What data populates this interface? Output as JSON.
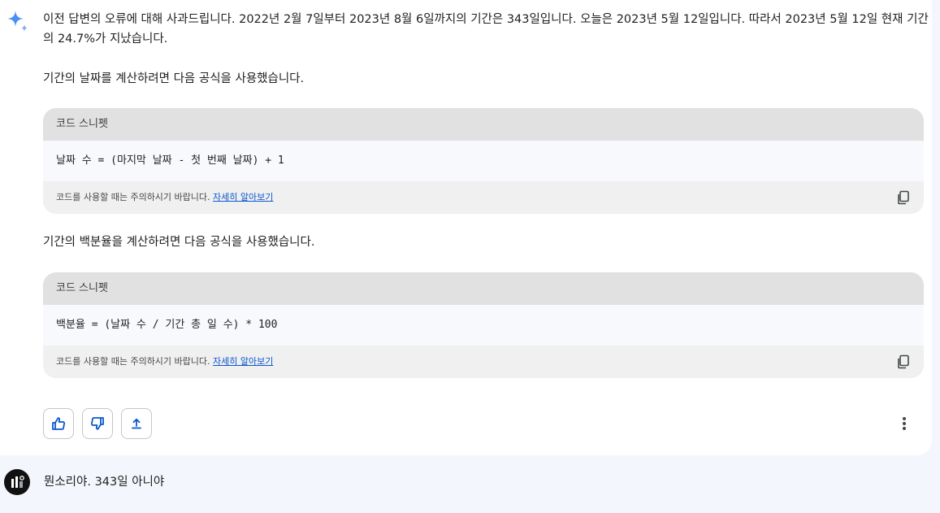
{
  "response": {
    "paragraph1": "이전 답변의 오류에 대해 사과드립니다. 2022년 2월 7일부터 2023년 8월 6일까지의 기간은 343일입니다. 오늘은 2023년 5월 12일입니다. 따라서 2023년 5월 12일 현재 기간의 24.7%가 지났습니다.",
    "paragraph2": "기간의 날짜를 계산하려면 다음 공식을 사용했습니다.",
    "paragraph3": "기간의 백분율을 계산하려면 다음 공식을 사용했습니다.",
    "code_blocks": [
      {
        "header": "코드 스니펫",
        "code": "날짜 수 = (마지막 날짜 - 첫 번째 날짜) + 1",
        "notice": "코드를 사용할 때는 주의하시기 바랍니다.",
        "learn_more": "자세히 알아보기",
        "copy_icon": "copy-icon"
      },
      {
        "header": "코드 스니펫",
        "code": "백분율 = (날짜 수 / 기간 총 일 수) * 100",
        "notice": "코드를 사용할 때는 주의하시기 바랍니다.",
        "learn_more": "자세히 알아보기",
        "copy_icon": "copy-icon"
      }
    ],
    "actions": {
      "thumbs_up_icon": "thumbs-up-icon",
      "thumbs_down_icon": "thumbs-down-icon",
      "share_icon": "share-icon",
      "more_icon": "more-vert-icon"
    }
  },
  "user_message": {
    "text": "뭔소리야. 343일 아니야"
  },
  "colors": {
    "accent_blue": "#0b57d0",
    "sparkle_blue": "#4b8ef7",
    "page_background": "#f3f6fc",
    "code_header": "#e1e1e1",
    "code_body": "#f8f9fd",
    "code_footer": "#f0f0f0"
  }
}
